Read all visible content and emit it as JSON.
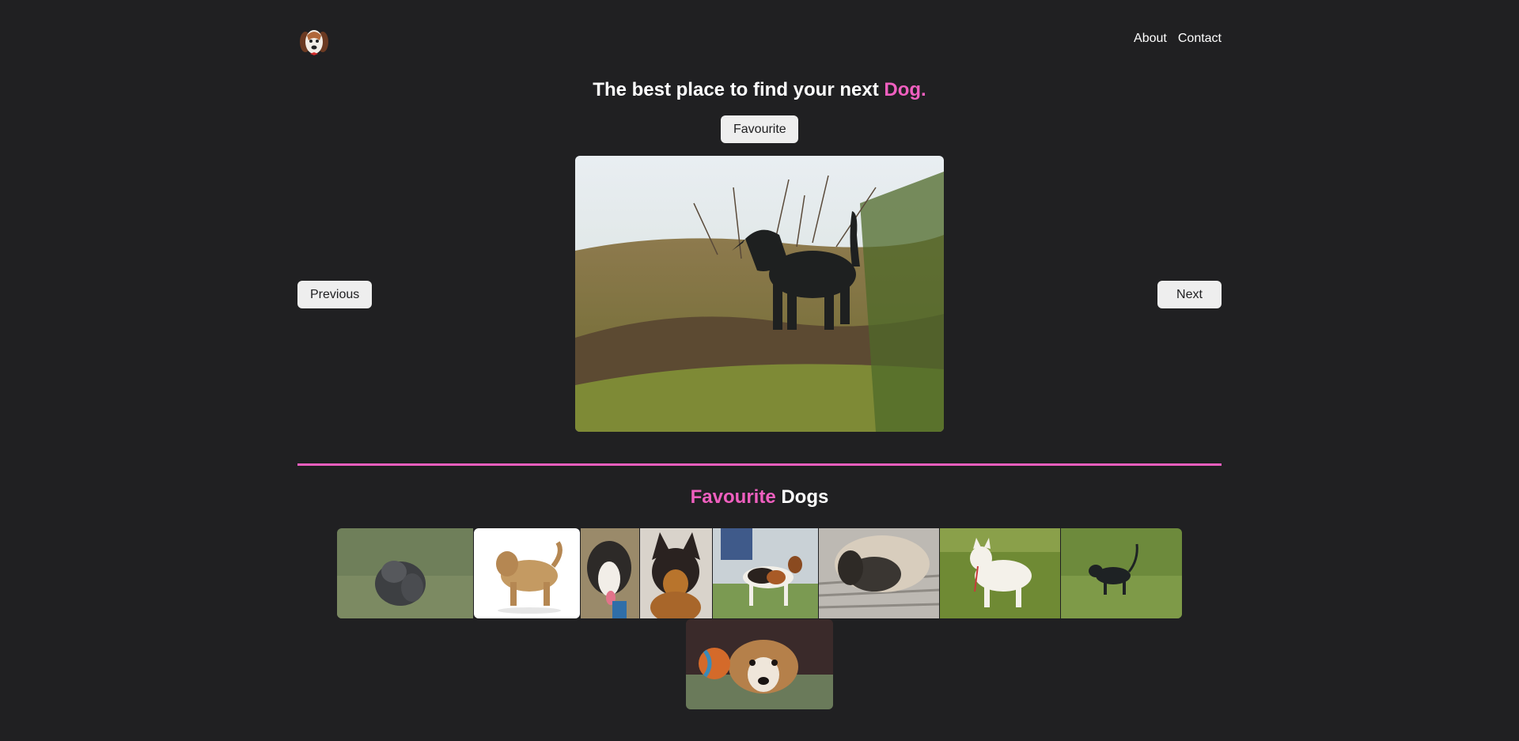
{
  "header": {
    "logo_icon": "dog-logo-icon",
    "nav": {
      "about": "About",
      "contact": "Contact"
    }
  },
  "hero": {
    "headline_prefix": "The best place to find your next ",
    "headline_accent": "Dog.",
    "favourite_button": "Favourite",
    "previous_button": "Previous",
    "next_button": "Next"
  },
  "favourites": {
    "title_accent": "Favourite",
    "title_rest": " Dogs"
  },
  "colors": {
    "background": "#202022",
    "accent": "#ef5fbf",
    "button_bg": "#eeeeee",
    "text": "#ffffff"
  }
}
